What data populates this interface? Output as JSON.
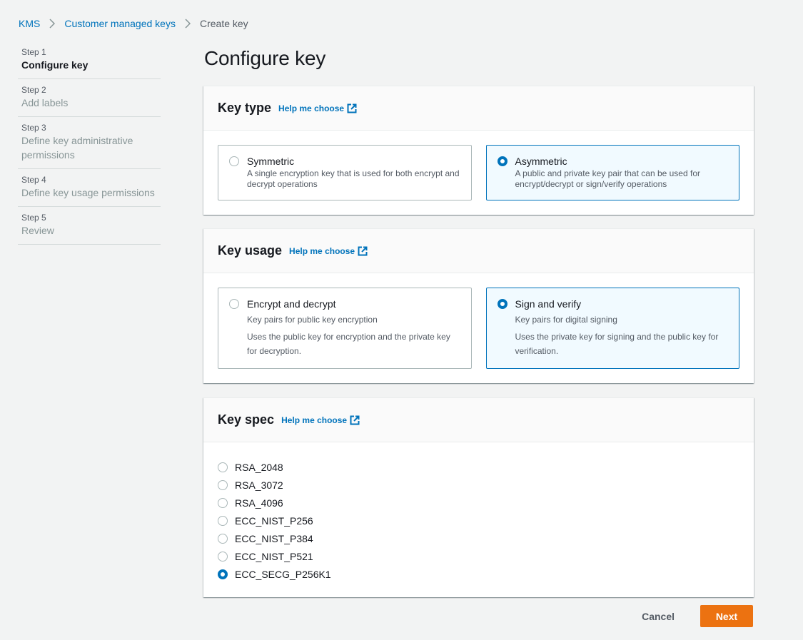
{
  "breadcrumb": {
    "items": [
      {
        "label": "KMS",
        "link": true
      },
      {
        "label": "Customer managed keys",
        "link": true
      },
      {
        "label": "Create key",
        "link": false
      }
    ]
  },
  "steps": [
    {
      "num": "Step 1",
      "title": "Configure key",
      "active": true
    },
    {
      "num": "Step 2",
      "title": "Add labels",
      "active": false
    },
    {
      "num": "Step 3",
      "title": "Define key administrative permissions",
      "active": false
    },
    {
      "num": "Step 4",
      "title": "Define key usage permissions",
      "active": false
    },
    {
      "num": "Step 5",
      "title": "Review",
      "active": false
    }
  ],
  "page_title": "Configure key",
  "key_type": {
    "title": "Key type",
    "help_link": "Help me choose",
    "options": [
      {
        "label": "Symmetric",
        "description": "A single encryption key that is used for both encrypt and decrypt operations",
        "selected": false
      },
      {
        "label": "Asymmetric",
        "description": "A public and private key pair that can be used for encrypt/decrypt or sign/verify operations",
        "selected": true
      }
    ]
  },
  "key_usage": {
    "title": "Key usage",
    "help_link": "Help me choose",
    "options": [
      {
        "label": "Encrypt and decrypt",
        "description": "Key pairs for public key encryption",
        "detail": "Uses the public key for encryption and the private key for decryption.",
        "selected": false
      },
      {
        "label": "Sign and verify",
        "description": "Key pairs for digital signing",
        "detail": "Uses the private key for signing and the public key for verification.",
        "selected": true
      }
    ]
  },
  "key_spec": {
    "title": "Key spec",
    "help_link": "Help me choose",
    "options": [
      {
        "label": "RSA_2048",
        "selected": false
      },
      {
        "label": "RSA_3072",
        "selected": false
      },
      {
        "label": "RSA_4096",
        "selected": false
      },
      {
        "label": "ECC_NIST_P256",
        "selected": false
      },
      {
        "label": "ECC_NIST_P384",
        "selected": false
      },
      {
        "label": "ECC_NIST_P521",
        "selected": false
      },
      {
        "label": "ECC_SECG_P256K1",
        "selected": true
      }
    ]
  },
  "actions": {
    "cancel_label": "Cancel",
    "next_label": "Next"
  },
  "colors": {
    "link": "#0073bb",
    "primary_button": "#ec7211",
    "selected_tile_bg": "#f1faff",
    "selected_tile_border": "#0073bb"
  }
}
